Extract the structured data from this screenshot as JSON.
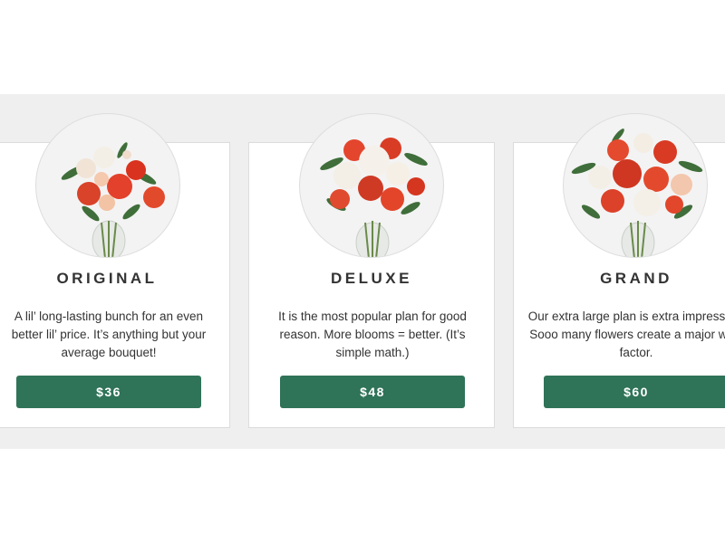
{
  "plans": [
    {
      "name": "ORIGINAL",
      "description": "A lil’ long-lasting bunch for an even better lil’ price. It’s anything but your average bouquet!",
      "price": "$36",
      "image": "bouquet-original"
    },
    {
      "name": "DELUXE",
      "description": "It is the most popular plan for good reason. More blooms = better. (It’s simple math.)",
      "price": "$48",
      "image": "bouquet-deluxe"
    },
    {
      "name": "GRAND",
      "description": "Our extra large plan is extra impressive. Sooo many flowers create a major wow factor.",
      "price": "$60",
      "image": "bouquet-grand"
    }
  ],
  "colors": {
    "accent": "#2f7358",
    "band": "#efefef",
    "card": "#ffffff",
    "text": "#333333"
  }
}
